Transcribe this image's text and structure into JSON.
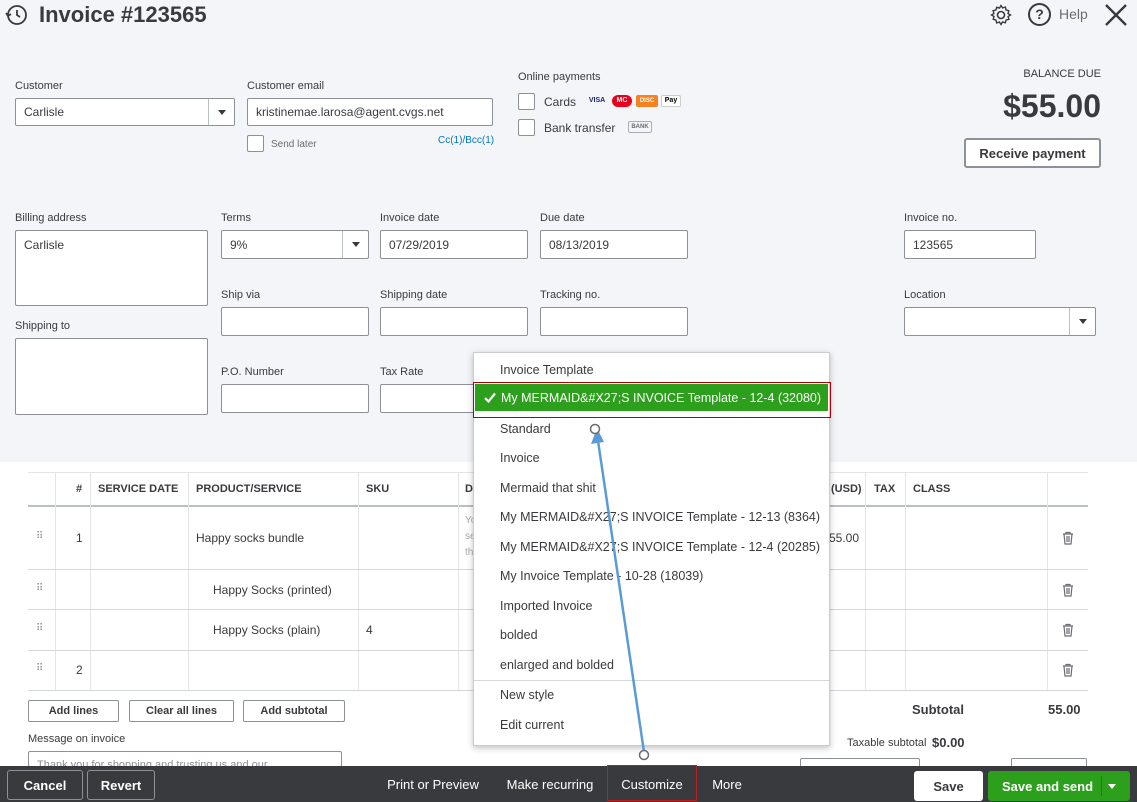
{
  "header": {
    "title": "Invoice #123565",
    "help_label": "Help"
  },
  "customer": {
    "label": "Customer",
    "value": "Carlisle"
  },
  "email": {
    "label": "Customer email",
    "value": "kristinemae.larosa@agent.cvgs.net",
    "send_later": "Send later",
    "cc_link": "Cc(1)/Bcc(1)"
  },
  "payments": {
    "label": "Online payments",
    "cards": "Cards",
    "bank": "Bank transfer",
    "card_icons": [
      "VISA",
      "MC",
      "DISC",
      "Pay"
    ],
    "bank_icon": "BANK"
  },
  "balance": {
    "label": "BALANCE DUE",
    "amount": "$55.00",
    "receive_button": "Receive payment"
  },
  "billing": {
    "label": "Billing address",
    "value": "Carlisle"
  },
  "shipping_to": {
    "label": "Shipping to",
    "value": ""
  },
  "terms": {
    "label": "Terms",
    "value": "9%"
  },
  "invoice_date": {
    "label": "Invoice date",
    "value": "07/29/2019"
  },
  "due_date": {
    "label": "Due date",
    "value": "08/13/2019"
  },
  "invoice_no": {
    "label": "Invoice no.",
    "value": "123565"
  },
  "ship_via": {
    "label": "Ship via",
    "value": ""
  },
  "shipping_date": {
    "label": "Shipping date",
    "value": ""
  },
  "tracking": {
    "label": "Tracking no.",
    "value": ""
  },
  "location": {
    "label": "Location",
    "value": ""
  },
  "po": {
    "label": "P.O. Number",
    "value": ""
  },
  "tax_rate": {
    "label": "Tax Rate",
    "value": ""
  },
  "table": {
    "headers": {
      "num": "#",
      "service_date": "SERVICE DATE",
      "product": "PRODUCT/SERVICE",
      "sku": "SKU",
      "desc": "D",
      "amount": "(USD)",
      "tax": "TAX",
      "class": "CLASS"
    },
    "rows": [
      {
        "num": "1",
        "product": "Happy socks bundle",
        "desc": "Yo",
        "desc2": "se",
        "desc3": "th",
        "amount": "55.00"
      },
      {
        "num": "",
        "product": "Happy Socks (printed)",
        "sku": ""
      },
      {
        "num": "",
        "product": "Happy Socks (plain)",
        "sku": "4"
      },
      {
        "num": "2",
        "product": ""
      }
    ]
  },
  "buttons": {
    "add_lines": "Add lines",
    "clear_all": "Clear all lines",
    "add_subtotal": "Add subtotal"
  },
  "totals": {
    "subtotal_label": "Subtotal",
    "subtotal_value": "55.00",
    "taxable_label": "Taxable subtotal",
    "taxable_value": "$0.00"
  },
  "message": {
    "label": "Message on invoice",
    "value": "Thank you for shopping and trusting us and our"
  },
  "footer": {
    "cancel": "Cancel",
    "revert": "Revert",
    "print": "Print or Preview",
    "recurring": "Make recurring",
    "customize": "Customize",
    "more": "More",
    "save": "Save",
    "save_send": "Save and send"
  },
  "template_menu": {
    "header": "Invoice Template",
    "selected": "My MERMAID&#X27;S INVOICE Template - 12-4 (32080)",
    "items": [
      "Standard",
      "Invoice",
      "Mermaid that shit",
      "My MERMAID&#X27;S INVOICE Template - 12-13 (8364)",
      "My MERMAID&#X27;S INVOICE Template - 12-4 (20285)",
      "My Invoice Template - 10-28 (18039)",
      "Imported Invoice",
      "bolded",
      "enlarged and bolded"
    ],
    "actions": [
      "New style",
      "Edit current"
    ]
  },
  "colors": {
    "accent_green": "#2ca01c",
    "link_blue": "#0077c5",
    "footer_bg": "#393a3d",
    "annotation_red": "#b5000b",
    "arrow_blue": "#5b9bd5"
  }
}
